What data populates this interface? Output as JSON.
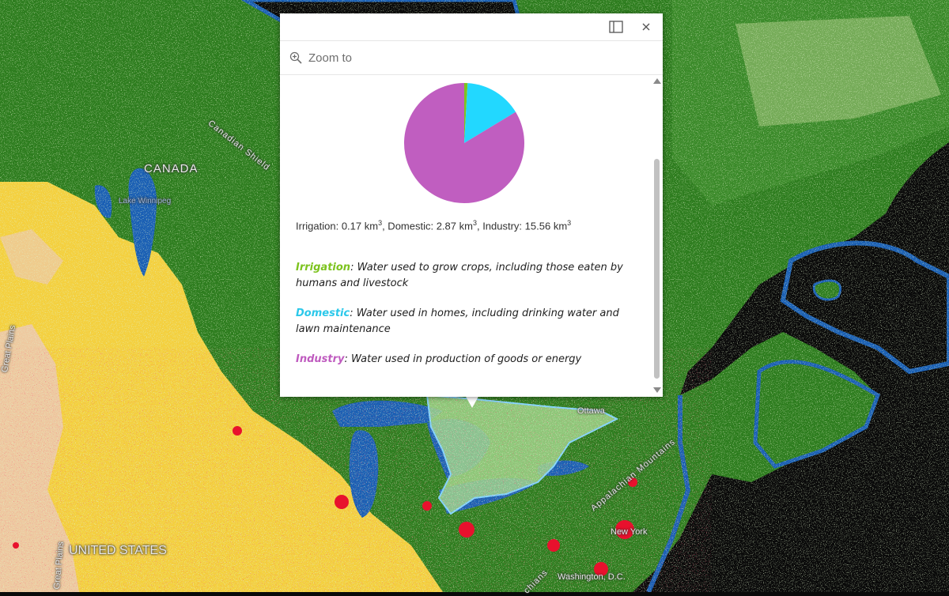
{
  "map": {
    "labels": {
      "canada": "CANADA",
      "united_states": "UNITED STATES",
      "canadian_shield": "Canadian Shield",
      "lake_winnipeg": "Lake Winnipeg",
      "great_plains": "Great Plains",
      "appalachian": "Appalachian Mountains",
      "ottawa": "Ottawa",
      "new_york": "New York",
      "washington": "Washington, D.C.",
      "appalachians_fragment": "chians"
    },
    "legend_colors": {
      "forest": "#2e7d1f",
      "cropland": "#f4d03f",
      "urban": "#e8112d",
      "water": "#1a5fb4",
      "grassland": "#9fd48a",
      "barren": "#eec9a0",
      "ocean": "#0a0a0a",
      "selected_region": "#7fd3ff"
    }
  },
  "popup": {
    "zoom_label": "Zoom to",
    "icons": {
      "dock": "dock-icon",
      "close": "close-icon",
      "zoom": "zoom-in-icon"
    },
    "totals": {
      "irrigation_label": "Irrigation: ",
      "irrigation_value": "0.17 km",
      "domestic_label": ", Domestic: ",
      "domestic_value": "2.87 km",
      "industry_label": ", Industry: ",
      "industry_value": "15.56 km",
      "unit_exp": "3"
    },
    "descriptions": {
      "irrigation_term": "Irrigation",
      "irrigation_text": ": Water used to grow crops, including those eaten by humans and livestock",
      "domestic_term": "Domestic",
      "domestic_text": ": Water used in homes, including drinking water and lawn maintenance",
      "industry_term": "Industry",
      "industry_text": ": Water used in production of goods or energy"
    },
    "term_colors": {
      "irrigation": "#7dc31f",
      "domestic": "#2bc8ea",
      "industry": "#bf5bbf"
    }
  },
  "chart_data": {
    "type": "pie",
    "categories": [
      "Irrigation",
      "Domestic",
      "Industry"
    ],
    "values": [
      0.17,
      2.87,
      15.56
    ],
    "colors": [
      "#7dc31f",
      "#22d8ff",
      "#c05ec0"
    ]
  }
}
